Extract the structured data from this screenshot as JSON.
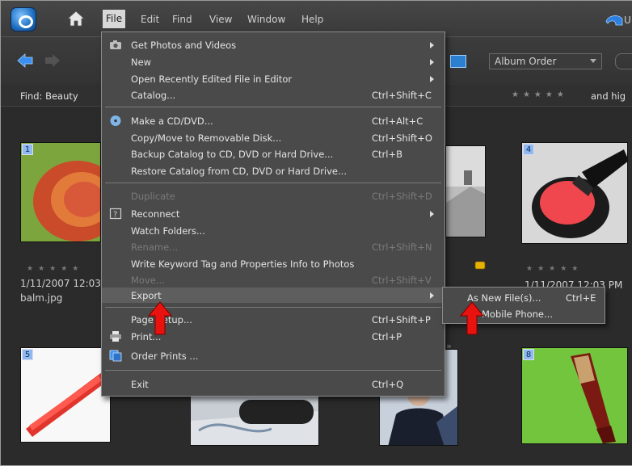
{
  "menubar": {
    "items": [
      "File",
      "Edit",
      "Find",
      "View",
      "Window",
      "Help"
    ],
    "undo_label": "U"
  },
  "toolbar": {
    "sort_value": "Album Order"
  },
  "findbar": {
    "label": "Find: Beauty",
    "rating_text": "and hig"
  },
  "photos": [
    {
      "number": "1",
      "date": "1/11/2007 12:03",
      "filename": "balm.jpg"
    },
    {
      "number": "4",
      "date": "1/11/2007 12:03 PM"
    },
    {
      "number": "5"
    },
    {
      "number": "8"
    }
  ],
  "file_menu": {
    "items": [
      {
        "label": "Get Photos and Videos",
        "shortcut": "",
        "submenu": true,
        "disabled": false
      },
      {
        "label": "New",
        "shortcut": "",
        "submenu": true,
        "disabled": false
      },
      {
        "label": "Open Recently Edited File in Editor",
        "shortcut": "",
        "submenu": true,
        "disabled": false
      },
      {
        "label": "Catalog...",
        "shortcut": "Ctrl+Shift+C",
        "submenu": false,
        "disabled": false
      },
      {
        "label": "Make a CD/DVD...",
        "shortcut": "Ctrl+Alt+C",
        "submenu": false,
        "disabled": false
      },
      {
        "label": "Copy/Move to Removable Disk...",
        "shortcut": "Ctrl+Shift+O",
        "submenu": false,
        "disabled": false
      },
      {
        "label": "Backup Catalog to CD, DVD or Hard Drive...",
        "shortcut": "Ctrl+B",
        "submenu": false,
        "disabled": false
      },
      {
        "label": "Restore Catalog from CD, DVD or Hard Drive...",
        "shortcut": "",
        "submenu": false,
        "disabled": false
      },
      {
        "label": "Duplicate",
        "shortcut": "Ctrl+Shift+D",
        "submenu": false,
        "disabled": true
      },
      {
        "label": "Reconnect",
        "shortcut": "",
        "submenu": true,
        "disabled": false
      },
      {
        "label": "Watch Folders...",
        "shortcut": "",
        "submenu": false,
        "disabled": false
      },
      {
        "label": "Rename...",
        "shortcut": "Ctrl+Shift+N",
        "submenu": false,
        "disabled": true
      },
      {
        "label": "Write Keyword Tag and Properties Info to Photos",
        "shortcut": "",
        "submenu": false,
        "disabled": false
      },
      {
        "label": "Move...",
        "shortcut": "Ctrl+Shift+V",
        "submenu": false,
        "disabled": true
      },
      {
        "label": "Export",
        "shortcut": "",
        "submenu": true,
        "disabled": false
      },
      {
        "label": "Page Setup...",
        "shortcut": "Ctrl+Shift+P",
        "submenu": false,
        "disabled": false
      },
      {
        "label": "Print...",
        "shortcut": "Ctrl+P",
        "submenu": false,
        "disabled": false
      },
      {
        "label": "Order Prints ...",
        "shortcut": "",
        "submenu": false,
        "disabled": false
      },
      {
        "label": "Exit",
        "shortcut": "Ctrl+Q",
        "submenu": false,
        "disabled": false
      }
    ]
  },
  "export_submenu": {
    "items": [
      {
        "label": "As New File(s)...",
        "shortcut": "Ctrl+E"
      },
      {
        "label": "Mobile Phone...",
        "shortcut": ""
      }
    ]
  },
  "colors": {
    "menu_bg": "#4a4a4a",
    "highlight": "#5e5e5e",
    "accent_arrow": "#e8130f",
    "badge": "#8fb9ef"
  }
}
